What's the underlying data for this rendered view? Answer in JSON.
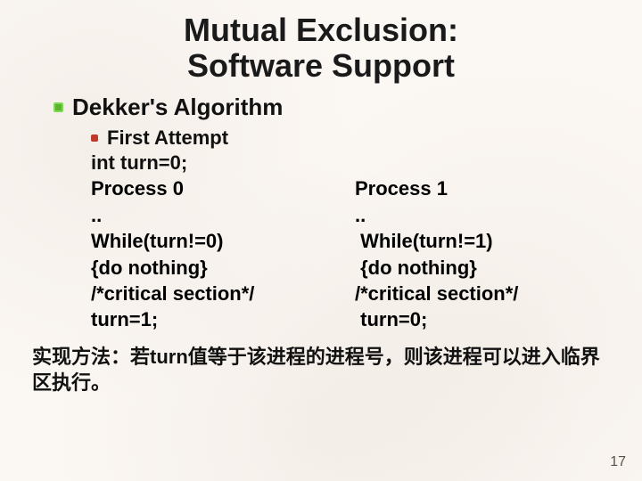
{
  "title_line1": "Mutual Exclusion:",
  "title_line2": "Software Support",
  "subtitle": "Dekker's Algorithm",
  "attempt": "First Attempt",
  "decl": "int turn=0;",
  "left": {
    "head": "Process 0",
    "dots": "..",
    "l1": "While(turn!=0)",
    "l2": "{do nothing}",
    "l3": "/*critical section*/",
    "l4": "turn=1;"
  },
  "right": {
    "head": "Process 1",
    "dots": "..",
    "l1": " While(turn!=1)",
    "l2": " {do nothing}",
    "l3": "/*critical section*/",
    "l4": " turn=0;"
  },
  "summary": "实现方法：若turn值等于该进程的进程号，则该进程可以进入临界区执行。",
  "page_number": "17"
}
